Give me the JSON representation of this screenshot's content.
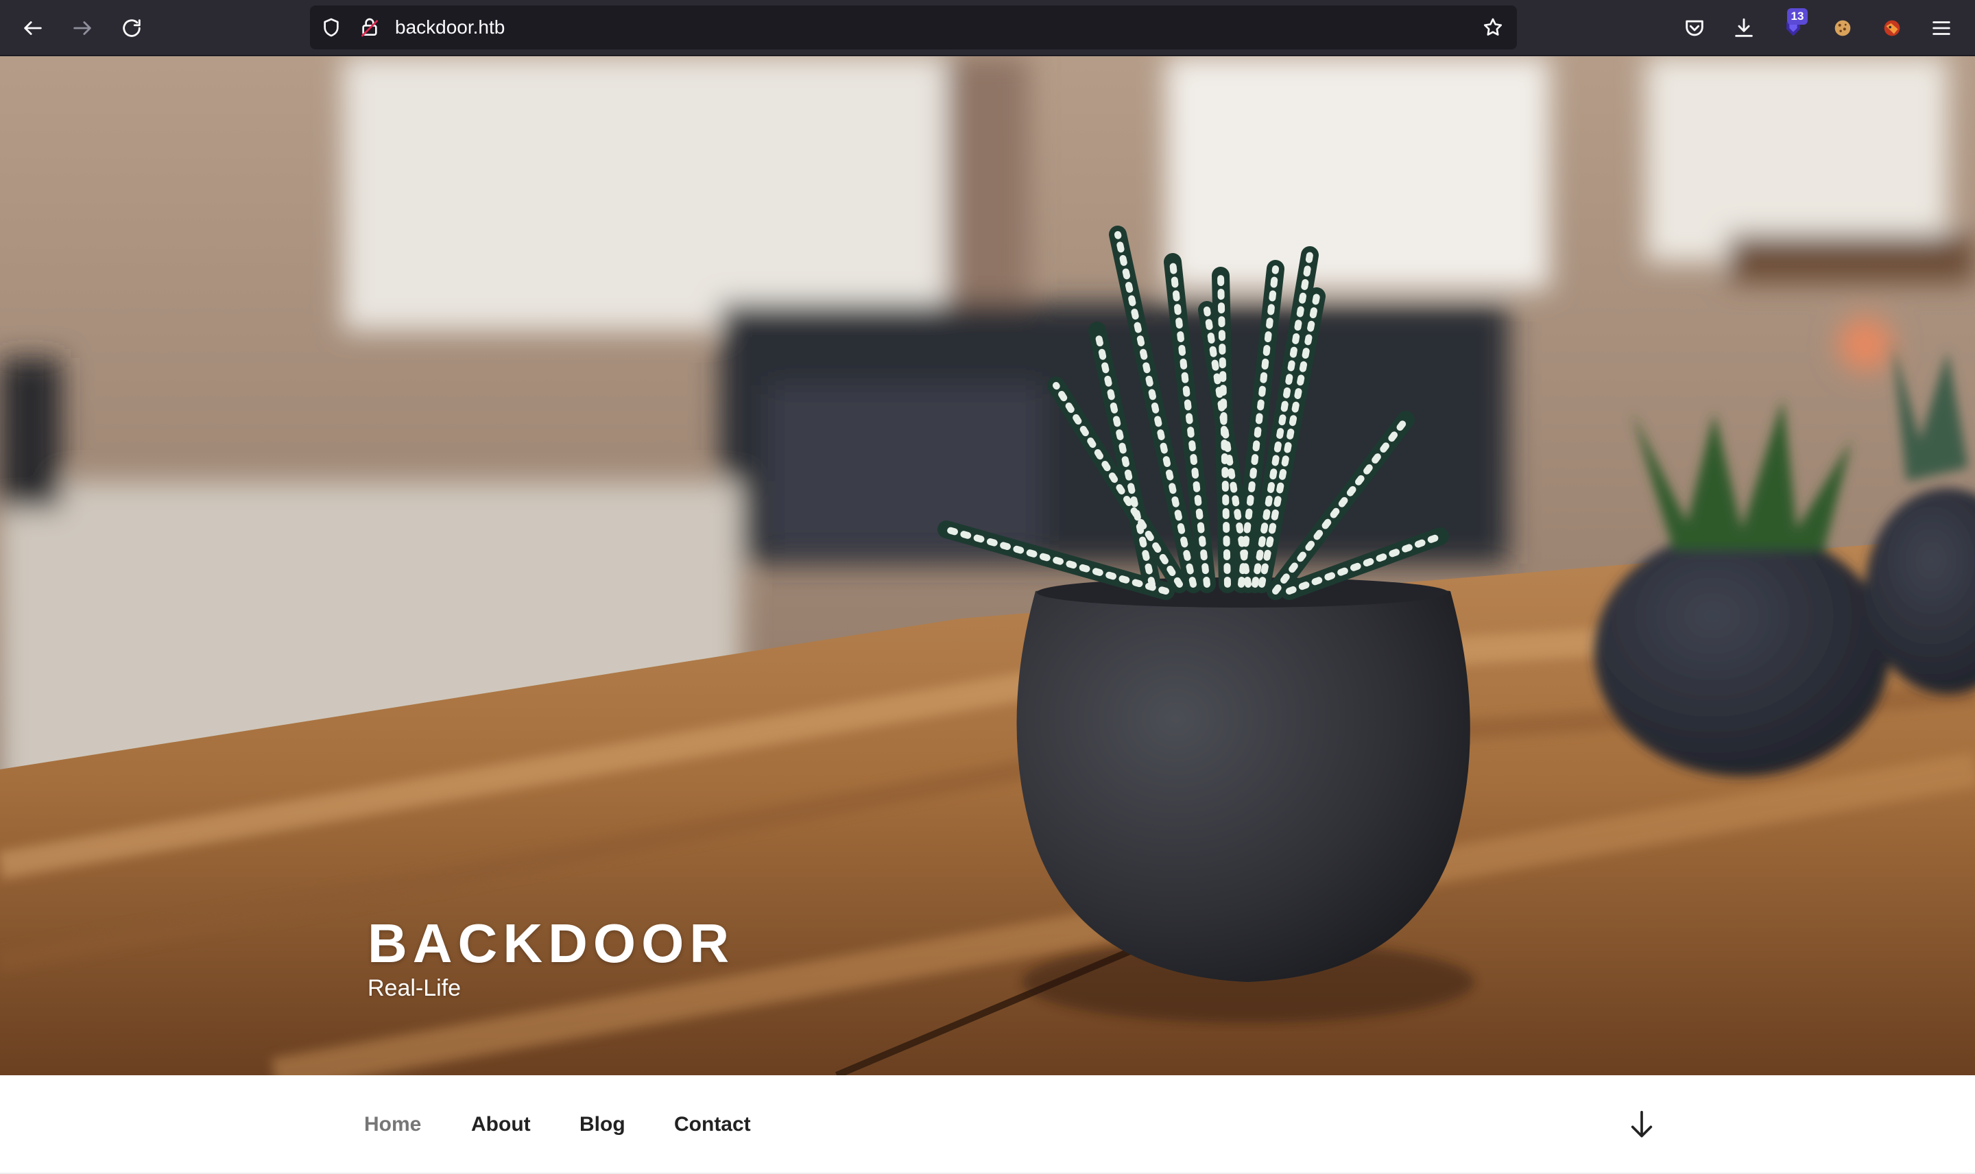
{
  "browser": {
    "url": "backdoor.htb",
    "extension_badge": "13",
    "toolbar_icons": [
      "back-arrow-icon",
      "forward-arrow-icon",
      "reload-icon",
      "shield-icon",
      "insecure-lock-icon",
      "bookmark-star-icon",
      "pocket-icon",
      "download-icon",
      "extension-icon",
      "cookie-icon",
      "foxy-icon",
      "hamburger-menu-icon"
    ]
  },
  "site": {
    "title": "BACKDOOR",
    "description": "Real-Life"
  },
  "nav": {
    "items": [
      {
        "label": "Home",
        "current": true
      },
      {
        "label": "About",
        "current": false
      },
      {
        "label": "Blog",
        "current": false
      },
      {
        "label": "Contact",
        "current": false
      }
    ],
    "scroll_icon": "arrow-down-icon"
  },
  "colors": {
    "toolbar_bg": "#2b2a33",
    "urlbar_bg": "#1c1b22",
    "nav_text": "#222222",
    "nav_current": "#767676"
  }
}
